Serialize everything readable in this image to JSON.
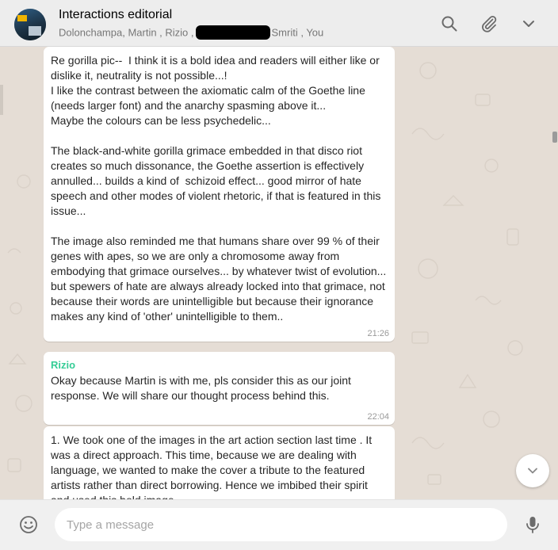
{
  "header": {
    "title": "Interactions editorial",
    "participants_before": "Dolonchampa, Martin , Rizio ,",
    "participants_after": "Smriti , You"
  },
  "messages": [
    {
      "sender": "",
      "text": "Re gorilla pic--  I think it is a bold idea and readers will either like or dislike it, neutrality is not possible...!\nI like the contrast between the axiomatic calm of the Goethe line (needs larger font) and the anarchy spasming above it...\nMaybe the colours can be less psychedelic...\n\nThe black-and-white gorilla grimace embedded in that disco riot creates so much dissonance, the Goethe assertion is effectively annulled... builds a kind of  schizoid effect... good mirror of hate speech and other modes of violent rhetoric, if that is featured in this issue...\n\nThe image also reminded me that humans share over 99 % of their genes with apes, so we are only a chromosome away from embodying that grimace ourselves... by whatever twist of evolution... but spewers of hate are always already locked into that grimace, not because their words are unintelligible but because their ignorance makes any kind of 'other' unintelligible to them..",
      "time": "21:26"
    },
    {
      "sender": "Rizio",
      "text": "Okay because Martin is with me, pls consider this as our joint response. We will share our thought process behind this.",
      "time": "22:04"
    },
    {
      "sender": "",
      "text": "1. We took one of the images in the art action section last time . It was a direct approach. This time, because we are dealing with language, we wanted to make the cover a tribute to the featured artists rather than direct borrowing. Hence we imbibed their spirit and used this bold image",
      "time": ""
    }
  ],
  "composer": {
    "placeholder": "Type a message"
  },
  "icons": {
    "search": "search-icon",
    "attach": "paperclip-icon",
    "menu": "chevron-down-icon",
    "emoji": "emoji-icon",
    "mic": "microphone-icon",
    "scroll_down": "chevron-down-icon"
  },
  "colors": {
    "chat_background": "#e5ddd5",
    "header_background": "#ededed",
    "sender_name": "#35cd96",
    "bubble": "#ffffff"
  }
}
